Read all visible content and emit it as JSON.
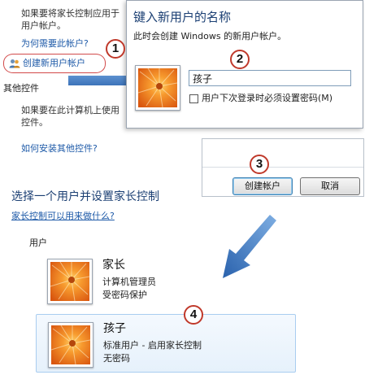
{
  "background_panel": {
    "line1": "如果要将家长控制应用于",
    "line2": "用户帐户。",
    "why_link": "为何需要此帐户?",
    "create_link": "创建新用户帐户",
    "other_controls_heading": "其他控件",
    "other_line1": "如果要在此计算机上使用",
    "other_line2": "控件。",
    "install_link": "如何安装其他控件?"
  },
  "steps": {
    "s1": "1",
    "s2": "2",
    "s3": "3",
    "s4": "4"
  },
  "new_user_dialog": {
    "title": "键入新用户的名称",
    "subtitle": "此时会创建 Windows 的新用户帐户。",
    "name_value": "孩子",
    "checkbox_label": "用户下次登录时必须设置密码(M)"
  },
  "buttons_dialog": {
    "create_label": "创建帐户",
    "cancel_label": "取消"
  },
  "select_section": {
    "title": "选择一个用户并设置家长控制",
    "link": "家长控制可以用来做什么?",
    "users_label": "用户"
  },
  "users": [
    {
      "name": "家长",
      "line1": "计算机管理员",
      "line2": "受密码保护"
    },
    {
      "name": "孩子",
      "line1": "标准用户 - 启用家长控制",
      "line2": "无密码"
    }
  ],
  "colors": {
    "link_blue": "#1e5aa8",
    "heading_blue": "#1b3f73",
    "arrow_blue": "#3b78c4",
    "step_ring": "#c0392b",
    "flower_orange": "#f07a1c"
  }
}
